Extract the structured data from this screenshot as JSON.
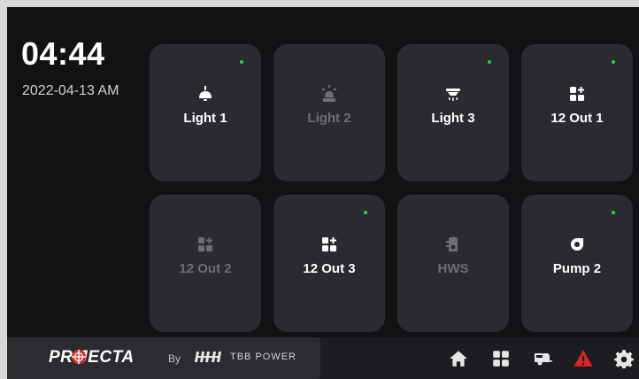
{
  "status": {
    "time": "04:44",
    "date": "2022-04-13 AM"
  },
  "tiles": [
    {
      "label": "Light 1",
      "icon": "ceiling-lamp-icon",
      "active": true
    },
    {
      "label": "Light 2",
      "icon": "beacon-light-icon",
      "active": false
    },
    {
      "label": "Light 3",
      "icon": "downlight-icon",
      "active": true
    },
    {
      "label": "12 Out 1",
      "icon": "grid-plus-icon",
      "active": true
    },
    {
      "label": "12 Out 2",
      "icon": "grid-plus-icon",
      "active": false
    },
    {
      "label": "12 Out 3",
      "icon": "grid-plus-icon",
      "active": true
    },
    {
      "label": "HWS",
      "icon": "water-heater-icon",
      "active": false
    },
    {
      "label": "Pump 2",
      "icon": "pump-icon",
      "active": true
    }
  ],
  "footer": {
    "brand": "PR JECTA",
    "by": "By",
    "partner": "TBB POWER",
    "nav": [
      "home-icon",
      "grid-icon",
      "caravan-icon",
      "alert-icon",
      "gear-icon"
    ]
  },
  "colors": {
    "indicator": "#25d24a",
    "alert": "#e02424",
    "tile": "#2a2b2f",
    "background": "#111214"
  }
}
